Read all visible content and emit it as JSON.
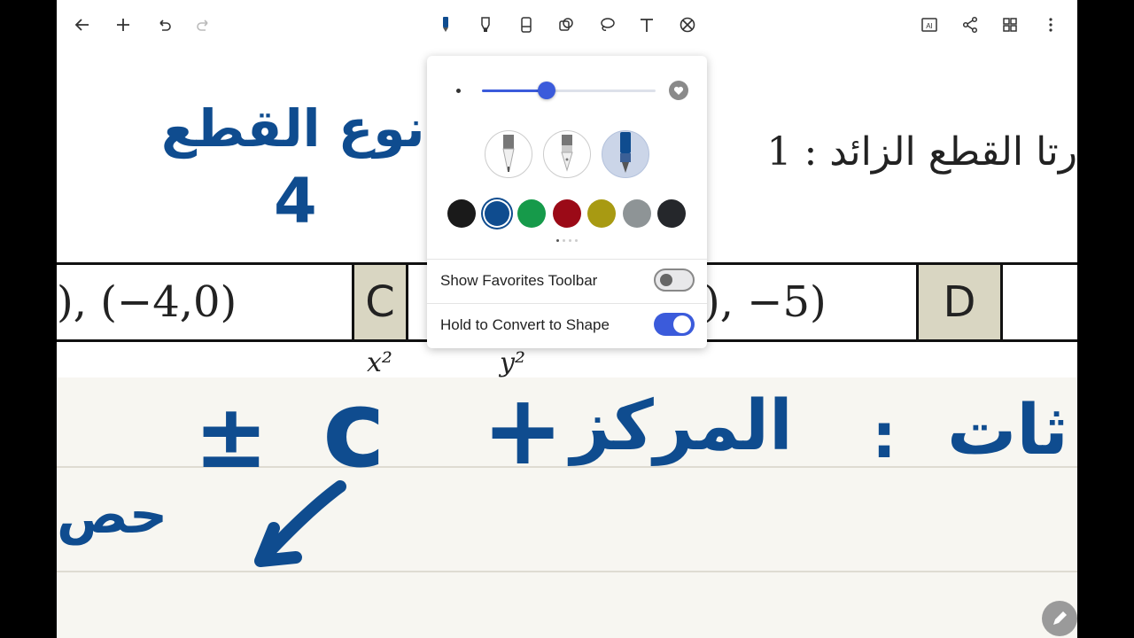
{
  "toolbar": {
    "left_icons": [
      "back-arrow-icon",
      "plus-icon",
      "undo-icon",
      "redo-icon"
    ],
    "tools": [
      "pen-icon",
      "highlighter-icon",
      "eraser-icon",
      "shapes-icon",
      "lasso-icon",
      "text-icon",
      "ruler-off-icon"
    ],
    "right_icons": [
      "ai-icon",
      "share-icon",
      "grid-icon",
      "more-vertical-icon"
    ],
    "ai_label": "AI"
  },
  "document": {
    "heading_ar": "رتا القطع الزائد : 1",
    "cell_left": "), (−4,0)",
    "cell_c": "C",
    "cell_mid": "), −5)",
    "cell_d": "D",
    "frac_x": "x²",
    "frac_y": "y²"
  },
  "handwriting": {
    "top_left_line1": "نوع القطع",
    "top_left_line2": "4",
    "plus_pm": "±",
    "c_letter": "c",
    "plus_center": "+",
    "center_word": "المركز",
    "colon": ":",
    "right_word": "ثات",
    "left_fragment": "حص"
  },
  "pen_popup": {
    "stroke_width_fraction": 0.37,
    "pen_types": [
      "ballpoint-pen",
      "fountain-pen",
      "brush-pen"
    ],
    "selected_pen": 2,
    "colors": [
      "#1a1a1a",
      "#0f4c8f",
      "#169a4a",
      "#9b0a17",
      "#a89a12",
      "#8e9496",
      "#25272b"
    ],
    "selected_color": 1,
    "favorites_toolbar_label": "Show Favorites Toolbar",
    "favorites_toolbar_on": false,
    "convert_shape_label": "Hold to Convert to Shape",
    "convert_shape_on": true
  },
  "accent_color": "#3b5bdb"
}
